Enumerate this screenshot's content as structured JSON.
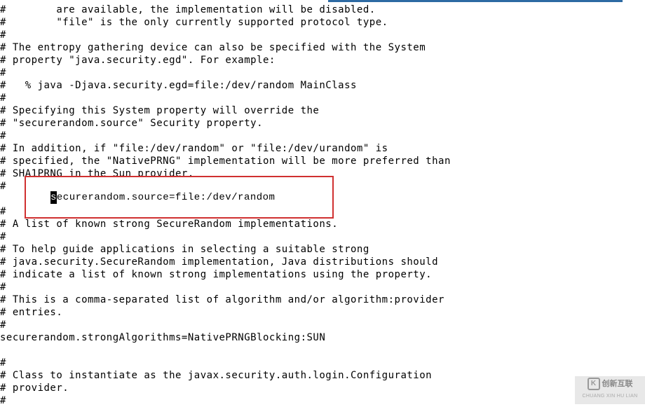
{
  "lines": [
    "#        are available, the implementation will be disabled.",
    "#        \"file\" is the only currently supported protocol type.",
    "#",
    "# The entropy gathering device can also be specified with the System",
    "# property \"java.security.egd\". For example:",
    "#",
    "#   % java -Djava.security.egd=file:/dev/random MainClass",
    "#",
    "# Specifying this System property will override the",
    "# \"securerandom.source\" Security property.",
    "#",
    "# In addition, if \"file:/dev/random\" or \"file:/dev/urandom\" is",
    "# specified, the \"NativePRNG\" implementation will be more preferred than",
    "# SHA1PRNG in the Sun provider.",
    "#",
    "",
    "#",
    "# A list of known strong SecureRandom implementations.",
    "#",
    "# To help guide applications in selecting a suitable strong",
    "# java.security.SecureRandom implementation, Java distributions should",
    "# indicate a list of known strong implementations using the property.",
    "#",
    "# This is a comma-separated list of algorithm and/or algorithm:provider",
    "# entries.",
    "#",
    "securerandom.strongAlgorithms=NativePRNGBlocking:SUN",
    "",
    "#",
    "# Class to instantiate as the javax.security.auth.login.Configuration",
    "# provider.",
    "#"
  ],
  "highlight": {
    "cursor_char": "s",
    "rest": "ecurerandom.source=file:/dev/random"
  },
  "watermark": {
    "glyph": "K",
    "cn": "创新互联",
    "sub": "CHUANG XIN HU LIAN"
  }
}
